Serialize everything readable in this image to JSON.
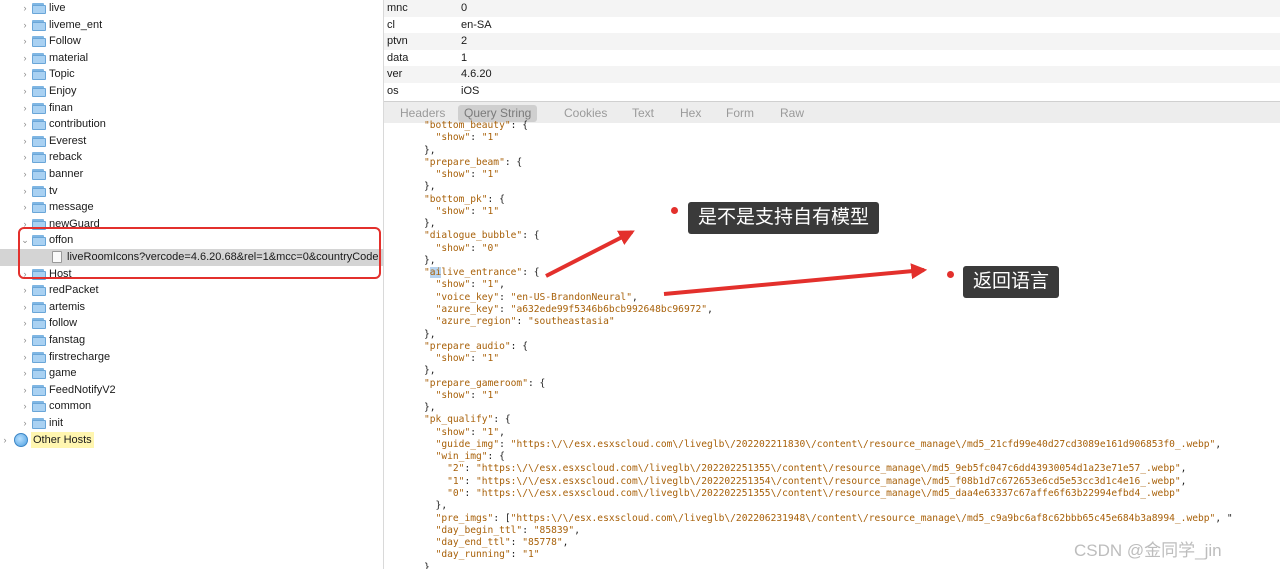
{
  "tree": {
    "items": [
      {
        "label": "live",
        "type": "folder",
        "indent": 1,
        "chevron": "›"
      },
      {
        "label": "liveme_ent",
        "type": "folder",
        "indent": 1,
        "chevron": "›"
      },
      {
        "label": "Follow",
        "type": "folder",
        "indent": 1,
        "chevron": "›"
      },
      {
        "label": "material",
        "type": "folder",
        "indent": 1,
        "chevron": "›"
      },
      {
        "label": "Topic",
        "type": "folder",
        "indent": 1,
        "chevron": "›"
      },
      {
        "label": "Enjoy",
        "type": "folder",
        "indent": 1,
        "chevron": "›"
      },
      {
        "label": "finan",
        "type": "folder",
        "indent": 1,
        "chevron": "›"
      },
      {
        "label": "contribution",
        "type": "folder",
        "indent": 1,
        "chevron": "›"
      },
      {
        "label": "Everest",
        "type": "folder",
        "indent": 1,
        "chevron": "›"
      },
      {
        "label": "reback",
        "type": "folder",
        "indent": 1,
        "chevron": "›"
      },
      {
        "label": "banner",
        "type": "folder",
        "indent": 1,
        "chevron": "›"
      },
      {
        "label": "tv",
        "type": "folder",
        "indent": 1,
        "chevron": "›"
      },
      {
        "label": "message",
        "type": "folder",
        "indent": 1,
        "chevron": "›"
      },
      {
        "label": "newGuard",
        "type": "folder",
        "indent": 1,
        "chevron": "›"
      },
      {
        "label": "offon",
        "type": "folder",
        "indent": 1,
        "chevron": "⌄"
      },
      {
        "label": "liveRoomIcons?vercode=4.6.20.68&rel=1&mcc=0&countryCode",
        "type": "file",
        "indent": 2,
        "chevron": "",
        "selected": true
      },
      {
        "label": "Host",
        "type": "folder",
        "indent": 1,
        "chevron": "›"
      },
      {
        "label": "redPacket",
        "type": "folder",
        "indent": 1,
        "chevron": "›"
      },
      {
        "label": "artemis",
        "type": "folder",
        "indent": 1,
        "chevron": "›"
      },
      {
        "label": "follow",
        "type": "folder",
        "indent": 1,
        "chevron": "›"
      },
      {
        "label": "fanstag",
        "type": "folder",
        "indent": 1,
        "chevron": "›"
      },
      {
        "label": "firstrecharge",
        "type": "folder",
        "indent": 1,
        "chevron": "›"
      },
      {
        "label": "game",
        "type": "folder",
        "indent": 1,
        "chevron": "›"
      },
      {
        "label": "FeedNotifyV2",
        "type": "folder",
        "indent": 1,
        "chevron": "›"
      },
      {
        "label": "common",
        "type": "folder",
        "indent": 1,
        "chevron": "›"
      },
      {
        "label": "init",
        "type": "folder",
        "indent": 1,
        "chevron": "›"
      },
      {
        "label": "Other Hosts",
        "type": "globe",
        "indent": 0,
        "chevron": "›"
      }
    ]
  },
  "query": {
    "rows": [
      {
        "key": "mnc",
        "value": "0"
      },
      {
        "key": "cl",
        "value": "en-SA"
      },
      {
        "key": "ptvn",
        "value": "2"
      },
      {
        "key": "data",
        "value": "1"
      },
      {
        "key": "ver",
        "value": "4.6.20"
      },
      {
        "key": "os",
        "value": "iOS"
      }
    ]
  },
  "tabs": [
    {
      "label": "Headers",
      "active": false
    },
    {
      "label": "Query String",
      "active": true
    },
    {
      "label": "Cookies",
      "active": false
    },
    {
      "label": "Text",
      "active": false
    },
    {
      "label": "Hex",
      "active": false
    },
    {
      "label": "Form",
      "active": false
    },
    {
      "label": "Raw",
      "active": false
    }
  ],
  "json_lines": [
    "\"bottom_beauty\": {",
    "  \"show\": \"1\"",
    "},",
    "\"prepare_beam\": {",
    "  \"show\": \"1\"",
    "},",
    "\"bottom_pk\": {",
    "  \"show\": \"1\"",
    "},",
    "\"dialogue_bubble\": {",
    "  \"show\": \"0\"",
    "},",
    "\"ailive_entrance\": {",
    "  \"show\": \"1\",",
    "  \"voice_key\": \"en-US-BrandonNeural\",",
    "  \"azure_key\": \"a632ede99f5346b6bcb992648bc96972\",",
    "  \"azure_region\": \"southeastasia\"",
    "},",
    "\"prepare_audio\": {",
    "  \"show\": \"1\"",
    "},",
    "\"prepare_gameroom\": {",
    "  \"show\": \"1\"",
    "},",
    "\"pk_qualify\": {",
    "  \"show\": \"1\",",
    "  \"guide_img\": \"https:\\/\\/esx.esxscloud.com\\/liveglb\\/202202211830\\/content\\/resource_manage\\/md5_21cfd99e40d27cd3089e161d906853f0_.webp\",",
    "  \"win_img\": {",
    "    \"2\": \"https:\\/\\/esx.esxscloud.com\\/liveglb\\/202202251355\\/content\\/resource_manage\\/md5_9eb5fc047c6dd43930054d1a23e71e57_.webp\",",
    "    \"1\": \"https:\\/\\/esx.esxscloud.com\\/liveglb\\/202202251354\\/content\\/resource_manage\\/md5_f08b1d7c672653e6cd5e53cc3d1c4e16_.webp\",",
    "    \"0\": \"https:\\/\\/esx.esxscloud.com\\/liveglb\\/202202251355\\/content\\/resource_manage\\/md5_daa4e63337c67affe6f63b22994efbd4_.webp\"",
    "  },",
    "  \"pre_imgs\": [\"https:\\/\\/esx.esxscloud.com\\/liveglb\\/202206231948\\/content\\/resource_manage\\/md5_c9a9bc6af8c62bbb65c45e684b3a8994_.webp\", \"",
    "  \"day_begin_ttl\": \"85839\",",
    "  \"day_end_ttl\": \"85778\",",
    "  \"day_running\": \"1\"",
    "}"
  ],
  "annotations": {
    "callout1": "是不是支持自有模型",
    "callout2": "返回语言",
    "accent_color": "#e3302c"
  },
  "watermark": "CSDN @金同学_jin"
}
